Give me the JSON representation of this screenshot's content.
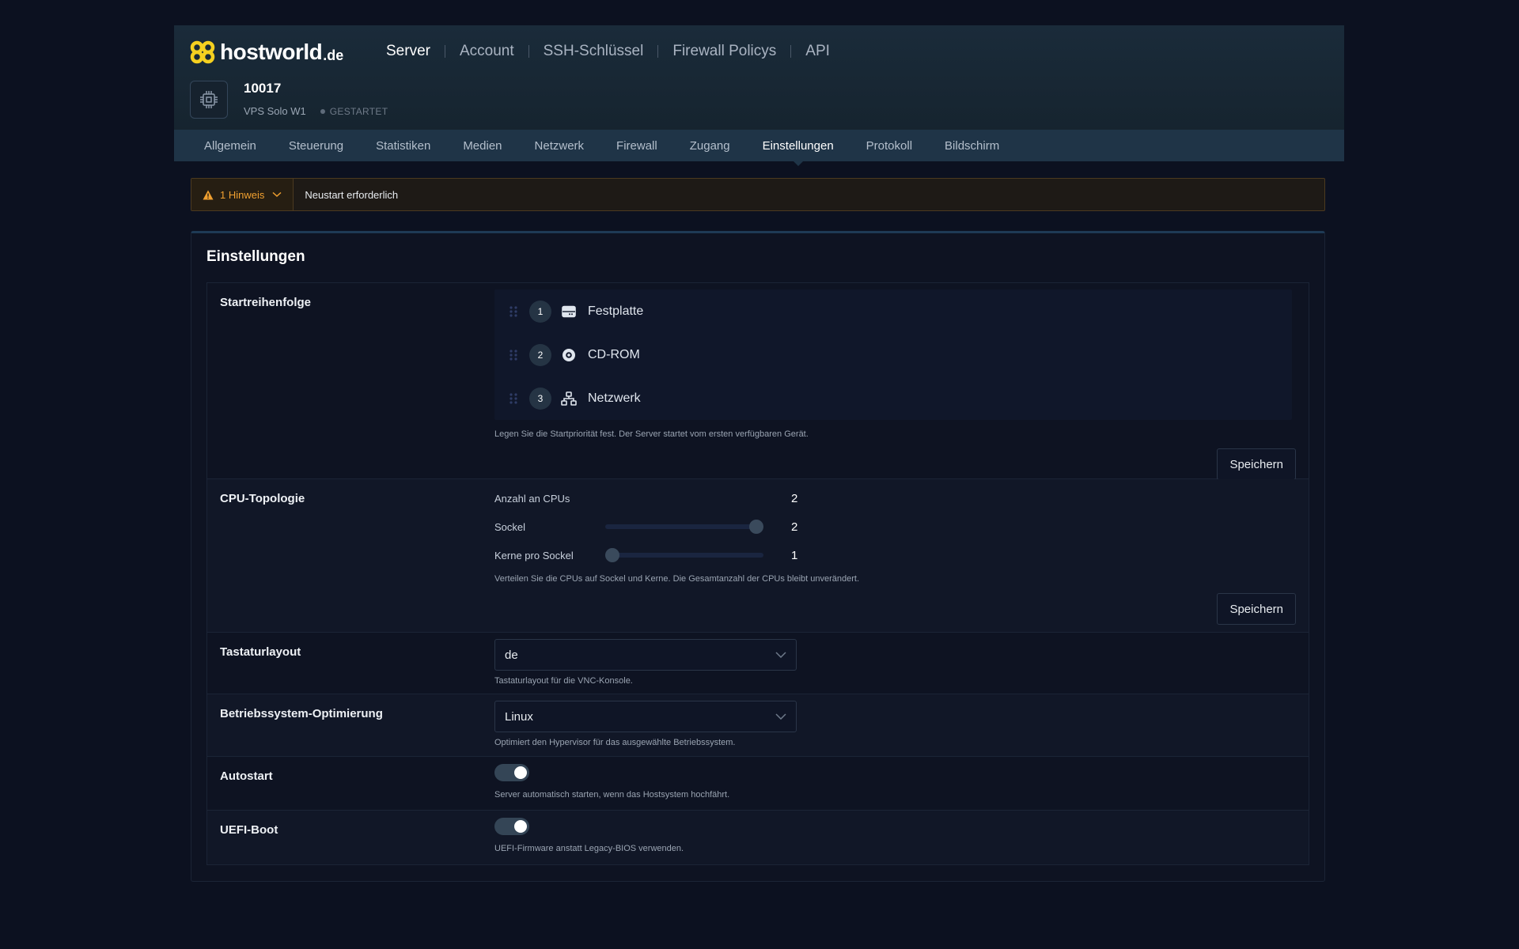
{
  "brand": {
    "name": "hostworld",
    "tld": ".de"
  },
  "topnav": [
    {
      "label": "Server",
      "active": true
    },
    {
      "label": "Account",
      "active": false
    },
    {
      "label": "SSH-Schlüssel",
      "active": false
    },
    {
      "label": "Firewall Policys",
      "active": false
    },
    {
      "label": "API",
      "active": false
    }
  ],
  "server": {
    "id": "10017",
    "plan": "VPS Solo W1",
    "status": "GESTARTET",
    "icon": "cpu-chip-icon"
  },
  "tabs": [
    {
      "label": "Allgemein",
      "active": false
    },
    {
      "label": "Steuerung",
      "active": false
    },
    {
      "label": "Statistiken",
      "active": false
    },
    {
      "label": "Medien",
      "active": false
    },
    {
      "label": "Netzwerk",
      "active": false
    },
    {
      "label": "Firewall",
      "active": false
    },
    {
      "label": "Zugang",
      "active": false
    },
    {
      "label": "Einstellungen",
      "active": true
    },
    {
      "label": "Protokoll",
      "active": false
    },
    {
      "label": "Bildschirm",
      "active": false
    }
  ],
  "alert": {
    "count_label": "1 Hinweis",
    "message": "Neustart erforderlich",
    "color": "#f0a030"
  },
  "card": {
    "title": "Einstellungen"
  },
  "boot_order": {
    "label": "Startreihenfolge",
    "items": [
      {
        "num": "1",
        "label": "Festplatte",
        "icon": "hard-drive-icon"
      },
      {
        "num": "2",
        "label": "CD-ROM",
        "icon": "disc-icon"
      },
      {
        "num": "3",
        "label": "Netzwerk",
        "icon": "network-icon"
      }
    ],
    "hint": "Legen Sie die Startpriorität fest. Der Server startet vom ersten verfügbaren Gerät.",
    "save_label": "Speichern"
  },
  "cpu": {
    "label": "CPU-Topologie",
    "count_label": "Anzahl an CPUs",
    "count_value": "2",
    "sockets_label": "Sockel",
    "sockets_value": "2",
    "sockets_fraction": 1.0,
    "cores_label": "Kerne pro Sockel",
    "cores_value": "1",
    "cores_fraction": 0.0,
    "hint": "Verteilen Sie die CPUs auf Sockel und Kerne. Die Gesamtanzahl der CPUs bleibt unverändert.",
    "save_label": "Speichern"
  },
  "keyboard": {
    "label": "Tastaturlayout",
    "value": "de",
    "hint": "Tastaturlayout für die VNC-Konsole."
  },
  "os_opt": {
    "label": "Betriebssystem-Optimierung",
    "value": "Linux",
    "hint": "Optimiert den Hypervisor für das ausgewählte Betriebssystem."
  },
  "autostart": {
    "label": "Autostart",
    "enabled": true,
    "hint": "Server automatisch starten, wenn das Hostsystem hochfährt."
  },
  "uefi": {
    "label": "UEFI-Boot",
    "enabled": true,
    "hint": "UEFI-Firmware anstatt Legacy-BIOS verwenden."
  }
}
